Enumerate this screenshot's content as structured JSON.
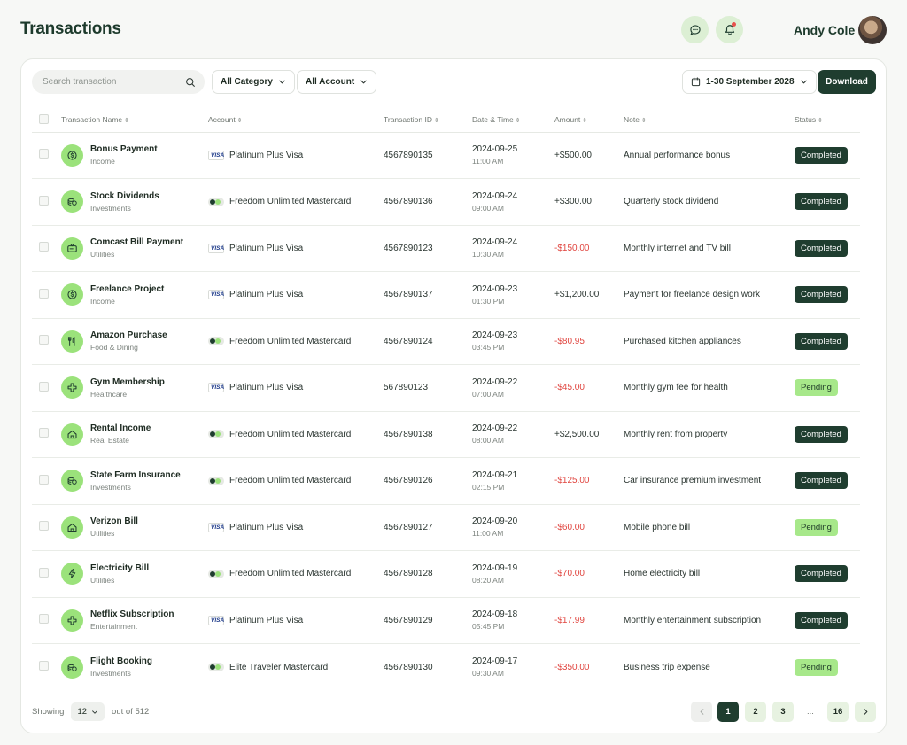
{
  "header": {
    "title": "Transactions",
    "user_name": "Andy Cole"
  },
  "toolbar": {
    "search_placeholder": "Search transaction",
    "category_filter": "All Category",
    "account_filter": "All Account",
    "date_range": "1-30 September 2028",
    "download_label": "Download"
  },
  "table": {
    "columns": {
      "name": "Transaction Name",
      "account": "Account",
      "id": "Transaction ID",
      "datetime": "Date & Time",
      "amount": "Amount",
      "note": "Note",
      "status": "Status"
    },
    "rows": [
      {
        "name": "Bonus Payment",
        "category": "Income",
        "icon": "income-icon",
        "card_type": "visa",
        "account": "Platinum Plus Visa",
        "id": "4567890135",
        "date": "2024-09-25",
        "time": "11:00 AM",
        "amount": "+$500.00",
        "amount_sign": "pos",
        "note": "Annual performance bonus",
        "status": "Completed"
      },
      {
        "name": "Stock Dividends",
        "category": "Investments",
        "icon": "investments-icon",
        "card_type": "mastercard",
        "account": "Freedom Unlimited Mastercard",
        "id": "4567890136",
        "date": "2024-09-24",
        "time": "09:00 AM",
        "amount": "+$300.00",
        "amount_sign": "pos",
        "note": "Quarterly stock dividend",
        "status": "Completed"
      },
      {
        "name": "Comcast Bill Payment",
        "category": "Utilities",
        "icon": "tv-icon",
        "card_type": "visa",
        "account": "Platinum Plus Visa",
        "id": "4567890123",
        "date": "2024-09-24",
        "time": "10:30 AM",
        "amount": "-$150.00",
        "amount_sign": "neg",
        "note": "Monthly internet and TV bill",
        "status": "Completed"
      },
      {
        "name": "Freelance Project",
        "category": "Income",
        "icon": "income-icon",
        "card_type": "visa",
        "account": "Platinum Plus Visa",
        "id": "4567890137",
        "date": "2024-09-23",
        "time": "01:30 PM",
        "amount": "+$1,200.00",
        "amount_sign": "pos",
        "note": "Payment for freelance design work",
        "status": "Completed"
      },
      {
        "name": "Amazon Purchase",
        "category": "Food & Dining",
        "icon": "utensils-icon",
        "card_type": "mastercard",
        "account": "Freedom Unlimited Mastercard",
        "id": "4567890124",
        "date": "2024-09-23",
        "time": "03:45 PM",
        "amount": "-$80.95",
        "amount_sign": "neg",
        "note": "Purchased kitchen appliances",
        "status": "Completed"
      },
      {
        "name": "Gym Membership",
        "category": "Healthcare",
        "icon": "health-cross-icon",
        "card_type": "visa",
        "account": "Platinum Plus Visa",
        "id": "567890123",
        "date": "2024-09-22",
        "time": "07:00 AM",
        "amount": "-$45.00",
        "amount_sign": "neg",
        "note": "Monthly gym fee for health",
        "status": "Pending"
      },
      {
        "name": "Rental Income",
        "category": "Real Estate",
        "icon": "house-icon",
        "card_type": "mastercard",
        "account": "Freedom Unlimited Mastercard",
        "id": "4567890138",
        "date": "2024-09-22",
        "time": "08:00 AM",
        "amount": "+$2,500.00",
        "amount_sign": "pos",
        "note": "Monthly rent from property",
        "status": "Completed"
      },
      {
        "name": "State Farm Insurance",
        "category": "Investments",
        "icon": "investments-icon",
        "card_type": "mastercard",
        "account": "Freedom Unlimited Mastercard",
        "id": "4567890126",
        "date": "2024-09-21",
        "time": "02:15 PM",
        "amount": "-$125.00",
        "amount_sign": "neg",
        "note": "Car insurance premium investment",
        "status": "Completed"
      },
      {
        "name": "Verizon Bill",
        "category": "Utilities",
        "icon": "house-icon",
        "card_type": "visa",
        "account": "Platinum Plus Visa",
        "id": "4567890127",
        "date": "2024-09-20",
        "time": "11:00 AM",
        "amount": "-$60.00",
        "amount_sign": "neg",
        "note": "Mobile phone bill",
        "status": "Pending"
      },
      {
        "name": "Electricity Bill",
        "category": "Utilities",
        "icon": "lightning-icon",
        "card_type": "mastercard",
        "account": "Freedom Unlimited Mastercard",
        "id": "4567890128",
        "date": "2024-09-19",
        "time": "08:20 AM",
        "amount": "-$70.00",
        "amount_sign": "neg",
        "note": "Home electricity bill",
        "status": "Completed"
      },
      {
        "name": "Netflix Subscription",
        "category": "Entertainment",
        "icon": "health-cross-icon",
        "card_type": "visa",
        "account": "Platinum Plus Visa",
        "id": "4567890129",
        "date": "2024-09-18",
        "time": "05:45 PM",
        "amount": "-$17.99",
        "amount_sign": "neg",
        "note": "Monthly entertainment subscription",
        "status": "Completed"
      },
      {
        "name": "Flight Booking",
        "category": "Investments",
        "icon": "investments-icon",
        "card_type": "mastercard",
        "account": "Elite Traveler Mastercard",
        "id": "4567890130",
        "date": "2024-09-17",
        "time": "09:30 AM",
        "amount": "-$350.00",
        "amount_sign": "neg",
        "note": "Business trip expense",
        "status": "Pending"
      }
    ]
  },
  "footer": {
    "showing_label": "Showing",
    "per_page": "12",
    "out_of_label": "out of 512",
    "pages": [
      "1",
      "2",
      "3",
      "...",
      "16"
    ],
    "current_page": "1"
  },
  "colors": {
    "primary_dark": "#1f3d2f",
    "accent_green": "#9be27b",
    "negative_red": "#e0453f"
  }
}
